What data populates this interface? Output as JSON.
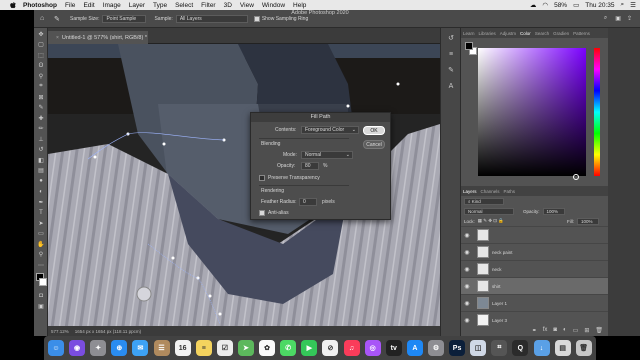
{
  "menubar": {
    "app_name": "Photoshop",
    "items": [
      "File",
      "Edit",
      "Image",
      "Layer",
      "Type",
      "Select",
      "Filter",
      "3D",
      "View",
      "Window",
      "Help"
    ],
    "battery": "58%",
    "clock": "Thu 20:35"
  },
  "window_title": "Adobe Photoshop 2020",
  "options_bar": {
    "sample_size_label": "Sample Size:",
    "sample_size_value": "Point Sample",
    "sample_label": "Sample:",
    "sample_value": "All Layers",
    "show_ring_label": "Show Sampling Ring"
  },
  "document_tab": "Untitled-1 @ 577% (shirt, RGB/8) *",
  "status_bar": {
    "zoom": "577.12%",
    "doc_size": "1654 px x 1654 px (118.11 ppcm)"
  },
  "panels": {
    "color_tabs": [
      "Learn",
      "Libraries",
      "Adjustm",
      "Color",
      "Search",
      "Gradien",
      "Patterns"
    ],
    "active_color_tab": "Color",
    "layer_tabs": [
      "Layers",
      "Channels",
      "Paths"
    ],
    "kind_label": "Kind",
    "blend_mode": "Normal",
    "opacity_label": "Opacity:",
    "opacity_value": "100%",
    "lock_label": "Lock:",
    "fill_label": "Fill:",
    "fill_value": "100%",
    "layers": [
      {
        "name": "",
        "thumb": "#e6e6e6"
      },
      {
        "name": "neck paint",
        "thumb": "#e6e6e6"
      },
      {
        "name": "neck",
        "thumb": "#e6e6e6"
      },
      {
        "name": "shirt",
        "thumb": "#e6e6e6",
        "selected": true
      },
      {
        "name": "Layer 1",
        "thumb": "#7d8894"
      },
      {
        "name": "Layer 3",
        "thumb": "#f2f2f2"
      }
    ]
  },
  "dialog": {
    "title": "Fill Path",
    "contents_label": "Contents:",
    "contents_value": "Foreground Color",
    "ok_label": "OK",
    "cancel_label": "Cancel",
    "blending_label": "Blending",
    "mode_label": "Mode:",
    "mode_value": "Normal",
    "opacity_label": "Opacity:",
    "opacity_value": "80",
    "opacity_unit": "%",
    "preserve_label": "Preserve Transparency",
    "rendering_label": "Rendering",
    "feather_label": "Feather Radius:",
    "feather_value": "0",
    "feather_unit": "pixels",
    "antialias_label": "Anti-alias"
  },
  "dock": {
    "icons": [
      {
        "name": "finder",
        "color": "#3b8ee8",
        "glyph": "☺"
      },
      {
        "name": "siri",
        "color": "#7a4de0",
        "glyph": "◉"
      },
      {
        "name": "launchpad",
        "color": "#8e8e93",
        "glyph": "✦"
      },
      {
        "name": "safari",
        "color": "#2a8cf0",
        "glyph": "⊕"
      },
      {
        "name": "mail",
        "color": "#3da2f5",
        "glyph": "✉"
      },
      {
        "name": "contacts",
        "color": "#b08a5e",
        "glyph": "☰"
      },
      {
        "name": "calendar",
        "color": "#f2f2f2",
        "glyph": "16"
      },
      {
        "name": "notes",
        "color": "#f4d35e",
        "glyph": "≡"
      },
      {
        "name": "reminders",
        "color": "#ececec",
        "glyph": "☑"
      },
      {
        "name": "maps",
        "color": "#5cb85c",
        "glyph": "➤"
      },
      {
        "name": "photos",
        "color": "#fafafa",
        "glyph": "✿"
      },
      {
        "name": "messages",
        "color": "#4cd964",
        "glyph": "✆"
      },
      {
        "name": "facetime",
        "color": "#34c759",
        "glyph": "▶"
      },
      {
        "name": "news",
        "color": "#f0f0f0",
        "glyph": "⊘"
      },
      {
        "name": "music",
        "color": "#fa3c5a",
        "glyph": "♫"
      },
      {
        "name": "podcasts",
        "color": "#a855f7",
        "glyph": "◎"
      },
      {
        "name": "tv",
        "color": "#222222",
        "glyph": "tv"
      },
      {
        "name": "app-store",
        "color": "#1e88f5",
        "glyph": "A"
      },
      {
        "name": "system-preferences",
        "color": "#8e8e93",
        "glyph": "⚙"
      },
      {
        "name": "photoshop",
        "color": "#0b1f3a",
        "glyph": "Ps"
      },
      {
        "name": "preview",
        "color": "#cfd8e6",
        "glyph": "◫"
      },
      {
        "name": "screenshot",
        "color": "#555555",
        "glyph": "⌗"
      },
      {
        "name": "quicktime",
        "color": "#2b2b2b",
        "glyph": "Q"
      },
      {
        "name": "downloads",
        "color": "#5aa0e6",
        "glyph": "↓"
      },
      {
        "name": "folder",
        "color": "#d9d9d9",
        "glyph": "▤"
      },
      {
        "name": "trash",
        "color": "#c7c7c7",
        "glyph": "🗑"
      }
    ]
  }
}
